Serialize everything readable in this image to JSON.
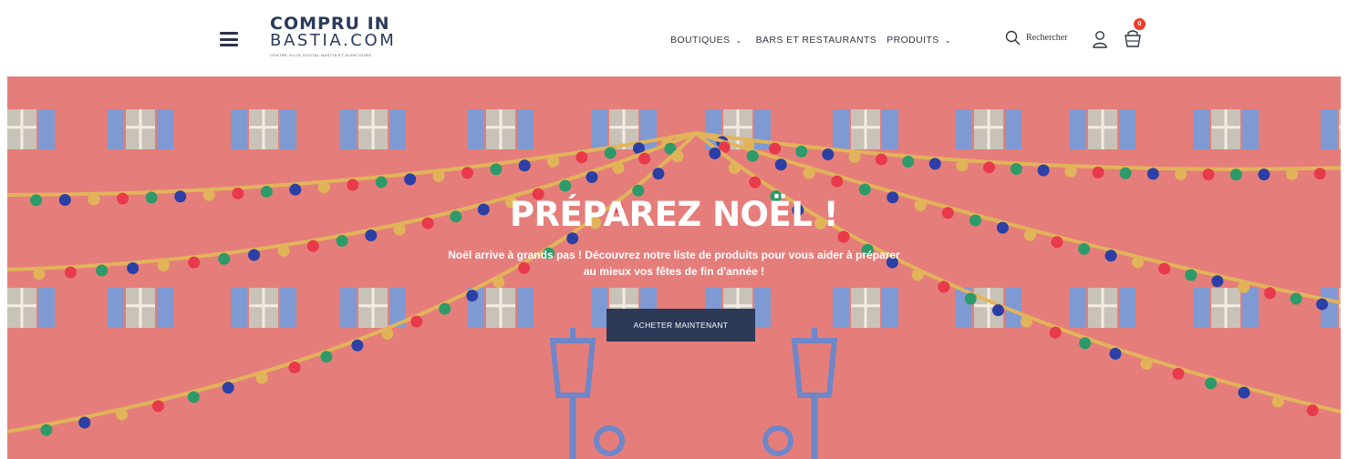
{
  "header": {
    "menu_icon": "hamburger-menu-icon",
    "logo": {
      "line1": "COMPRU IN",
      "line2": "BASTIA.COM",
      "tagline": "CENTRE VILLE DIGITAL BASTIA ET ALENTOURS"
    },
    "nav": [
      {
        "label": "BOUTIQUES",
        "has_dropdown": true
      },
      {
        "label": "BARS ET RESTAURANTS",
        "has_dropdown": false
      },
      {
        "label": "PRODUITS",
        "has_dropdown": true
      }
    ],
    "search_label": "Rechercher",
    "cart_count": "0",
    "icons": [
      "search-icon",
      "user-icon",
      "cart-icon",
      "chevron-down-icon"
    ]
  },
  "hero": {
    "title": "PRÉPAREZ NOËL !",
    "subtitle_line1": "Noël arrive à grands pas ! Découvrez notre liste de produits pour vous aider à préparer",
    "subtitle_line2": "au mieux vos fêtes de fin d'année !",
    "cta_label": "ACHETER MAINTENANT"
  },
  "colors": {
    "hero_background": "#e57e7a",
    "cta_background": "#2c3957",
    "logo": "#2b3a5c",
    "badge": "#ef3b2c",
    "garland": "#e2b45a",
    "window_shutter": "#7f9ad2",
    "window_glass": "#c9c2b8"
  }
}
